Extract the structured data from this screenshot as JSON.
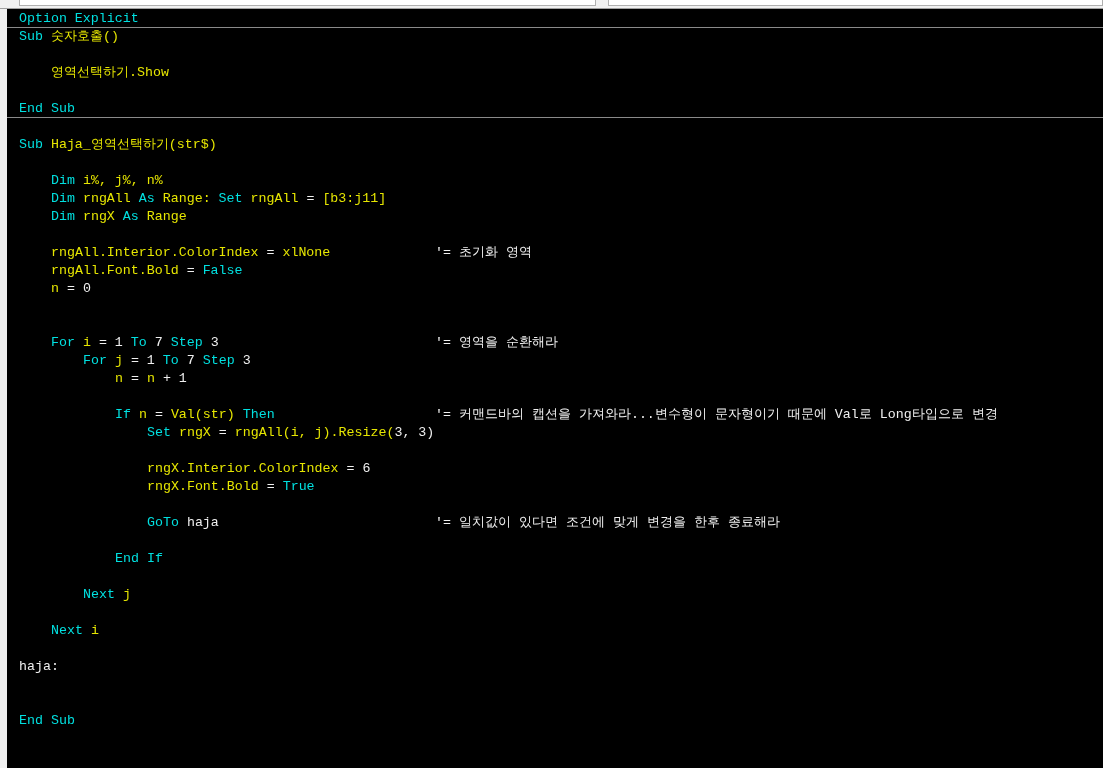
{
  "code_lines": [
    {
      "tokens": [
        {
          "kind": "keyword",
          "text": "Option Explicit"
        }
      ],
      "separator": true
    },
    {
      "tokens": [
        {
          "kind": "keyword",
          "text": "Sub"
        },
        {
          "kind": "ident",
          "text": " 숫자호출()"
        }
      ],
      "children": [
        {
          "tokens": [
            {
              "kind": "ident",
              "text": "영역선택하기.Show"
            }
          ]
        }
      ]
    },
    {
      "tokens": [
        {
          "kind": "keyword",
          "text": "End Sub"
        }
      ],
      "separator": true
    },
    {
      "tokens": [
        {
          "kind": "keyword",
          "text": "Sub"
        },
        {
          "kind": "ident",
          "text": " Haja_영역선택하기(str$)"
        }
      ],
      "children": [
        {
          "tokens": [
            {
              "kind": "keyword",
              "text": "Dim"
            },
            {
              "kind": "ident",
              "text": " i%, j%, n%"
            }
          ]
        },
        {
          "tokens": [
            {
              "kind": "keyword",
              "text": "Dim"
            },
            {
              "kind": "ident",
              "text": " rngAll "
            },
            {
              "kind": "keyword",
              "text": "As"
            },
            {
              "kind": "ident",
              "text": " Range: "
            },
            {
              "kind": "keyword",
              "text": "Set"
            },
            {
              "kind": "ident",
              "text": " rngAll "
            },
            {
              "kind": "plain",
              "text": "= "
            },
            {
              "kind": "ident",
              "text": "[b3:j11]"
            }
          ]
        },
        {
          "tokens": [
            {
              "kind": "keyword",
              "text": "Dim"
            },
            {
              "kind": "ident",
              "text": " rngX "
            },
            {
              "kind": "keyword",
              "text": "As"
            },
            {
              "kind": "ident",
              "text": " Range"
            }
          ]
        },
        {
          "tokens": [
            {
              "kind": "ident",
              "text": "rngAll.Interior.ColorIndex "
            },
            {
              "kind": "plain",
              "text": "= "
            },
            {
              "kind": "ident",
              "text": "xlNone"
            }
          ],
          "comment": "'= 초기화 영역"
        },
        {
          "tokens": [
            {
              "kind": "ident",
              "text": "rngAll.Font.Bold "
            },
            {
              "kind": "plain",
              "text": "= "
            },
            {
              "kind": "keyword",
              "text": "False"
            }
          ]
        },
        {
          "tokens": [
            {
              "kind": "ident",
              "text": "n "
            },
            {
              "kind": "plain",
              "text": "= 0"
            }
          ]
        },
        {
          "tokens": [
            {
              "kind": "keyword",
              "text": "For"
            },
            {
              "kind": "ident",
              "text": " i "
            },
            {
              "kind": "plain",
              "text": "= 1 "
            },
            {
              "kind": "keyword",
              "text": "To"
            },
            {
              "kind": "plain",
              "text": " 7 "
            },
            {
              "kind": "keyword",
              "text": "Step"
            },
            {
              "kind": "plain",
              "text": " 3"
            }
          ],
          "comment": "'= 영역을 순환해라",
          "children": [
            {
              "tokens": [
                {
                  "kind": "keyword",
                  "text": "For"
                },
                {
                  "kind": "ident",
                  "text": " j "
                },
                {
                  "kind": "plain",
                  "text": "= 1 "
                },
                {
                  "kind": "keyword",
                  "text": "To"
                },
                {
                  "kind": "plain",
                  "text": " 7 "
                },
                {
                  "kind": "keyword",
                  "text": "Step"
                },
                {
                  "kind": "plain",
                  "text": " 3"
                }
              ],
              "children": [
                {
                  "tokens": [
                    {
                      "kind": "ident",
                      "text": "n "
                    },
                    {
                      "kind": "plain",
                      "text": "= "
                    },
                    {
                      "kind": "ident",
                      "text": "n "
                    },
                    {
                      "kind": "plain",
                      "text": "+ 1"
                    }
                  ]
                },
                {
                  "tokens": [
                    {
                      "kind": "keyword",
                      "text": "If"
                    },
                    {
                      "kind": "ident",
                      "text": " n "
                    },
                    {
                      "kind": "plain",
                      "text": "= "
                    },
                    {
                      "kind": "ident",
                      "text": "Val(str) "
                    },
                    {
                      "kind": "keyword",
                      "text": "Then"
                    }
                  ],
                  "comment": "'= 커맨드바의 캡션을 가져와라...변수형이 문자형이기 때문에 Val로 Long타입으로 변경",
                  "children": [
                    {
                      "tokens": [
                        {
                          "kind": "keyword",
                          "text": "Set"
                        },
                        {
                          "kind": "ident",
                          "text": " rngX "
                        },
                        {
                          "kind": "plain",
                          "text": "= "
                        },
                        {
                          "kind": "ident",
                          "text": "rngAll(i, j).Resize("
                        },
                        {
                          "kind": "plain",
                          "text": "3, 3)"
                        }
                      ]
                    },
                    {
                      "tokens": [
                        {
                          "kind": "ident",
                          "text": "rngX.Interior.ColorIndex "
                        },
                        {
                          "kind": "plain",
                          "text": "= 6"
                        }
                      ]
                    },
                    {
                      "tokens": [
                        {
                          "kind": "ident",
                          "text": "rngX.Font.Bold "
                        },
                        {
                          "kind": "plain",
                          "text": "= "
                        },
                        {
                          "kind": "keyword",
                          "text": "True"
                        }
                      ]
                    },
                    {
                      "tokens": [
                        {
                          "kind": "keyword",
                          "text": "GoTo"
                        },
                        {
                          "kind": "plain",
                          "text": " haja"
                        }
                      ],
                      "comment": "'= 일치값이 있다면 조건에 맞게 변경을 한후 종료해라"
                    }
                  ]
                },
                {
                  "tokens": [
                    {
                      "kind": "keyword",
                      "text": "End If"
                    }
                  ]
                }
              ]
            },
            {
              "tokens": [
                {
                  "kind": "keyword",
                  "text": "Next"
                },
                {
                  "kind": "ident",
                  "text": " j"
                }
              ]
            }
          ]
        },
        {
          "tokens": [
            {
              "kind": "keyword",
              "text": "Next"
            },
            {
              "kind": "ident",
              "text": " i"
            }
          ]
        }
      ]
    },
    {
      "tokens": [
        {
          "kind": "plain",
          "text": "haja:"
        }
      ]
    },
    {
      "tokens": [
        {
          "kind": "keyword",
          "text": "End Sub"
        }
      ]
    }
  ]
}
